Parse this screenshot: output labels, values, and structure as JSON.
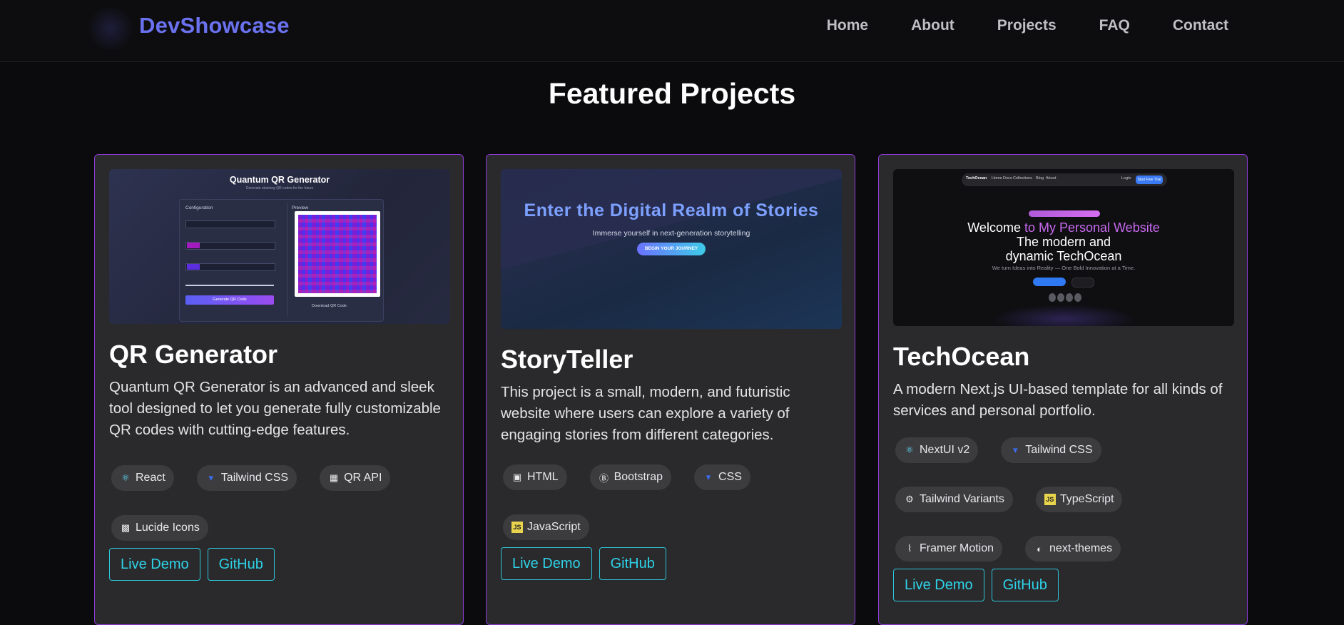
{
  "brand": "DevShowcase",
  "nav": [
    "Home",
    "About",
    "Projects",
    "FAQ",
    "Contact"
  ],
  "section_title": "Featured Projects",
  "projects": [
    {
      "title": "QR Generator",
      "description": "Quantum QR Generator is an advanced and sleek tool designed to let you generate fully customizable QR codes with cutting-edge features.",
      "preview": {
        "heading": "Quantum QR Generator",
        "subheading": "Generate stunning QR codes for the future",
        "config_label": "Configuration",
        "preview_label": "Preview",
        "generate_label": "Generate QR Code",
        "download_label": "Download QR Code"
      },
      "tags": [
        {
          "label": "React",
          "icon": "react-icon"
        },
        {
          "label": "Tailwind CSS",
          "icon": "css-icon"
        },
        {
          "label": "QR API",
          "icon": "qr-icon"
        },
        {
          "label": "Lucide Icons",
          "icon": "lucide-icon"
        }
      ],
      "links": {
        "demo": "Live Demo",
        "github": "GitHub"
      }
    },
    {
      "title": "StoryTeller",
      "description": "This project is a small, modern, and futuristic website where users can explore a variety of engaging stories from different categories.",
      "preview": {
        "heading": "Enter the Digital Realm of Stories",
        "subheading": "Immerse yourself in next-generation storytelling",
        "button": "BEGIN YOUR JOURNEY"
      },
      "tags": [
        {
          "label": "HTML",
          "icon": "html-icon"
        },
        {
          "label": "Bootstrap",
          "icon": "bootstrap-icon"
        },
        {
          "label": "CSS",
          "icon": "css-icon"
        },
        {
          "label": "JavaScript",
          "icon": "javascript-icon"
        }
      ],
      "links": {
        "demo": "Live Demo",
        "github": "GitHub"
      }
    },
    {
      "title": "TechOcean",
      "description": "A modern Next.js UI-based template for all kinds of services and personal portfolio.",
      "preview": {
        "brand": "TechOcean",
        "nav": [
          "Home",
          "Docs",
          "Collections",
          "Blog",
          "About"
        ],
        "login": "Login",
        "cta": "Start Free Trial",
        "heading_a": "Welcome ",
        "heading_b": "to My Personal Website",
        "heading_c": "The modern and dynamic TechOcean",
        "subheading": "We turn Ideas into Reality — One Bold Innovation at a Time."
      },
      "tags": [
        {
          "label": "NextUI v2",
          "icon": "react-icon"
        },
        {
          "label": "Tailwind CSS",
          "icon": "css-icon"
        },
        {
          "label": "Tailwind Variants",
          "icon": "gears-icon"
        },
        {
          "label": "TypeScript",
          "icon": "typescript-icon"
        },
        {
          "label": "Framer Motion",
          "icon": "motion-icon"
        },
        {
          "label": "next-themes",
          "icon": "theme-icon"
        }
      ],
      "links": {
        "demo": "Live Demo",
        "github": "GitHub"
      }
    }
  ],
  "colors": {
    "accent": "#6b72f0",
    "card_border": "#8e3bd6",
    "link": "#2fd2e8"
  }
}
